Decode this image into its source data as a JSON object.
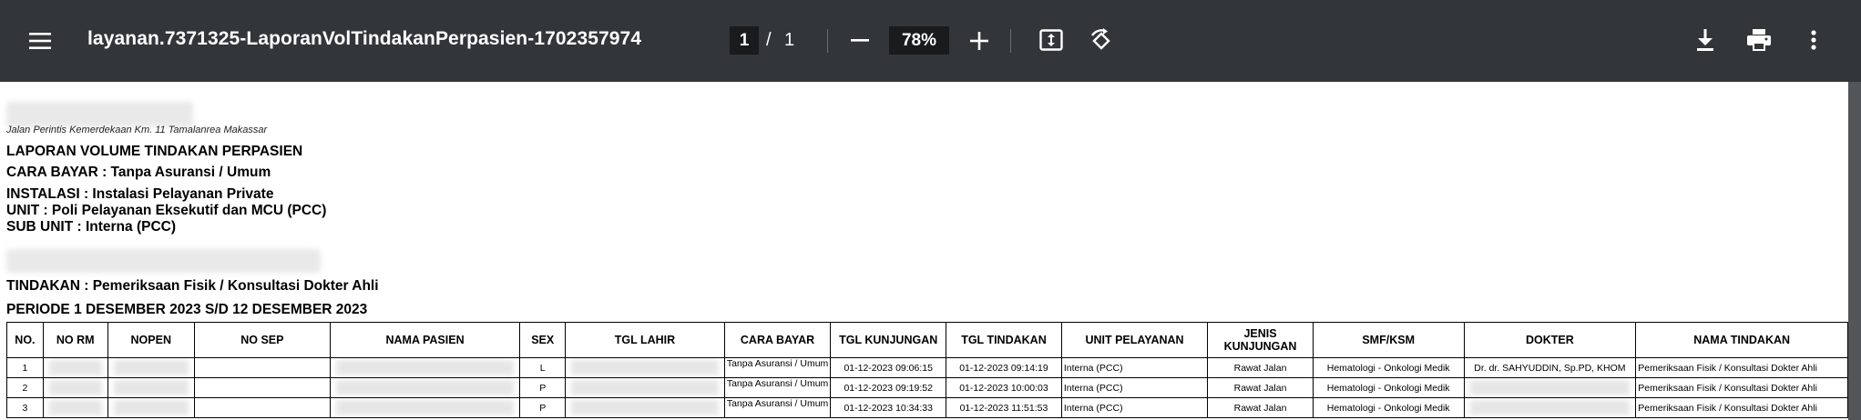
{
  "toolbar": {
    "menu_icon": "menu-icon",
    "title": "layanan.7371325-LaporanVolTindakanPerpasien-1702357974",
    "page_current": "1",
    "page_separator": "/",
    "page_total": "1",
    "zoom": "78%",
    "icons": [
      "zoom-out-icon",
      "zoom-in-icon",
      "fit-page-icon",
      "rotate-icon",
      "download-icon",
      "print-icon",
      "more-vert-icon"
    ]
  },
  "report": {
    "address": "Jalan Perintis Kemerdekaan Km. 11 Tamalanrea Makassar",
    "title": "LAPORAN VOLUME TINDAKAN PERPASIEN",
    "cara_bayar": "CARA BAYAR : Tanpa Asuransi / Umum",
    "instalasi": "INSTALASI : Instalasi Pelayanan Private",
    "unit": "UNIT : Poli Pelayanan Eksekutif dan MCU (PCC)",
    "sub_unit": "SUB UNIT : Interna (PCC)",
    "tindakan": "TINDAKAN : Pemeriksaan Fisik / Konsultasi Dokter Ahli",
    "periode": "PERIODE 1 DESEMBER 2023 S/D 12 DESEMBER 2023",
    "columns": [
      "NO.",
      "NO RM",
      "NOPEN",
      "NO SEP",
      "NAMA PASIEN",
      "SEX",
      "TGL LAHIR",
      "CARA BAYAR",
      "TGL KUNJUNGAN",
      "TGL TINDAKAN",
      "UNIT PELAYANAN",
      "JENIS KUNJUNGAN",
      "SMF/KSM",
      "DOKTER",
      "NAMA TINDAKAN"
    ],
    "rows": [
      {
        "no": "1",
        "sex": "L",
        "cara_bayar": "Tanpa Asuransi / Umum",
        "tgl_kunjungan": "01-12-2023 09:06:15",
        "tgl_tindakan": "01-12-2023 09:14:19",
        "unit": "Interna (PCC)",
        "jenis": "Rawat Jalan",
        "smf": "Hematologi - Onkologi Medik",
        "dokter": "Dr. dr. SAHYUDDIN, Sp.PD, KHOM",
        "tindakan": "Pemeriksaan Fisik / Konsultasi Dokter Ahli"
      },
      {
        "no": "2",
        "sex": "P",
        "cara_bayar": "Tanpa Asuransi / Umum",
        "tgl_kunjungan": "01-12-2023 09:19:52",
        "tgl_tindakan": "01-12-2023 10:00:03",
        "unit": "Interna (PCC)",
        "jenis": "Rawat Jalan",
        "smf": "Hematologi - Onkologi Medik",
        "dokter": "",
        "tindakan": "Pemeriksaan Fisik / Konsultasi Dokter Ahli"
      },
      {
        "no": "3",
        "sex": "P",
        "cara_bayar": "Tanpa Asuransi / Umum",
        "tgl_kunjungan": "01-12-2023 10:34:33",
        "tgl_tindakan": "01-12-2023 11:51:53",
        "unit": "Interna (PCC)",
        "jenis": "Rawat Jalan",
        "smf": "Hematologi - Onkologi Medik",
        "dokter": "",
        "tindakan": "Pemeriksaan Fisik / Konsultasi Dokter Ahli"
      }
    ]
  }
}
